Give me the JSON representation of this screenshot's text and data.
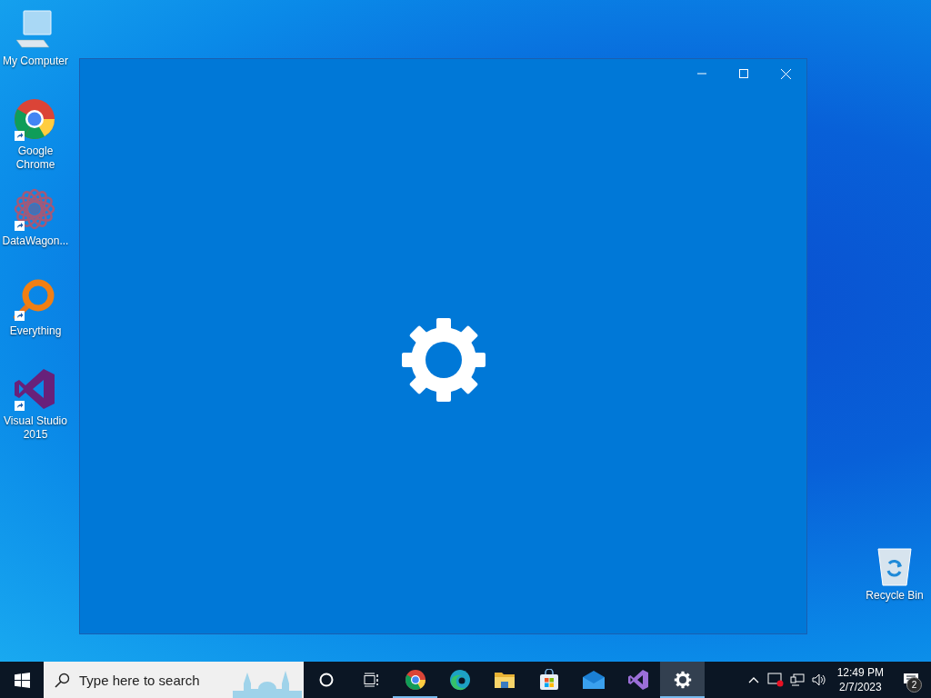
{
  "desktop_icons": [
    {
      "kind": "computer",
      "label": "My Computer",
      "shortcut": false
    },
    {
      "kind": "chrome",
      "label": "Google Chrome",
      "shortcut": true
    },
    {
      "kind": "datawagon",
      "label": "DataWagon...",
      "shortcut": true
    },
    {
      "kind": "everything",
      "label": "Everything",
      "shortcut": true
    },
    {
      "kind": "visualstudio",
      "label": "Visual Studio 2015",
      "shortcut": true
    }
  ],
  "recycle_bin": {
    "label": "Recycle Bin"
  },
  "taskbar": {
    "search": {
      "placeholder": "Type here to search"
    },
    "apps": [
      {
        "kind": "cortana",
        "running": false,
        "selected": false
      },
      {
        "kind": "taskview",
        "running": false,
        "selected": false
      },
      {
        "kind": "chrome",
        "running": true,
        "selected": false
      },
      {
        "kind": "edge",
        "running": false,
        "selected": false
      },
      {
        "kind": "explorer",
        "running": false,
        "selected": false
      },
      {
        "kind": "store",
        "running": false,
        "selected": false
      },
      {
        "kind": "mail",
        "running": false,
        "selected": false
      },
      {
        "kind": "visualstudio",
        "running": false,
        "selected": false
      },
      {
        "kind": "settings",
        "running": true,
        "selected": true
      }
    ],
    "clock": {
      "time": "12:49 PM",
      "date": "2/7/2023"
    },
    "notifications": {
      "count": "2"
    }
  }
}
